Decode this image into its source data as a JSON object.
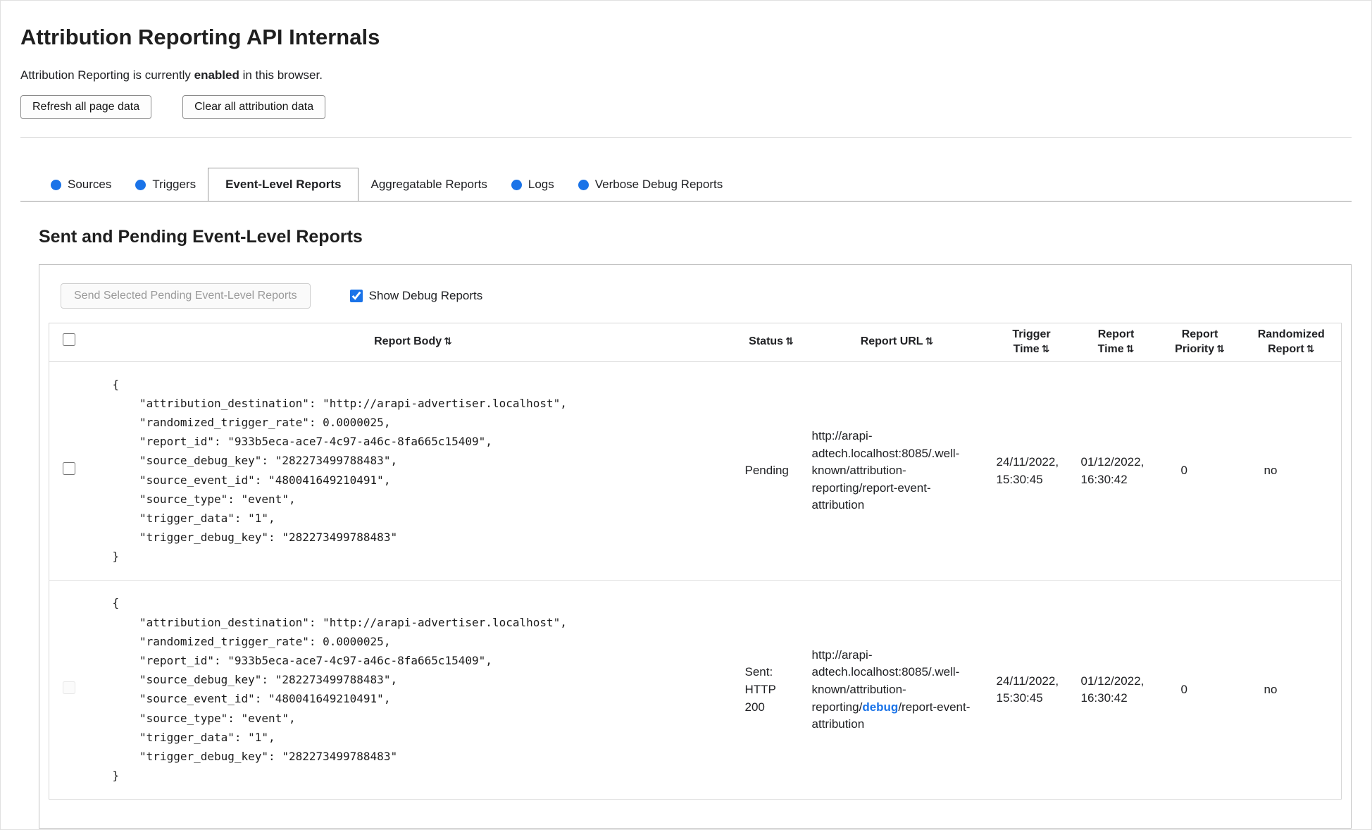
{
  "colors": {
    "accent_blue": "#1a73e8",
    "debug_link_blue": "#1a73e8"
  },
  "header": {
    "title": "Attribution Reporting API Internals",
    "status_prefix": "Attribution Reporting is currently ",
    "status_emphasis": "enabled",
    "status_suffix": " in this browser.",
    "refresh_button": "Refresh all page data",
    "clear_button": "Clear all attribution data"
  },
  "tabs": [
    {
      "label": "Sources",
      "has_dot": true,
      "active": false
    },
    {
      "label": "Triggers",
      "has_dot": true,
      "active": false
    },
    {
      "label": "Event-Level Reports",
      "has_dot": false,
      "active": true
    },
    {
      "label": "Aggregatable Reports",
      "has_dot": false,
      "active": false
    },
    {
      "label": "Logs",
      "has_dot": true,
      "active": false
    },
    {
      "label": "Verbose Debug Reports",
      "has_dot": true,
      "active": false
    }
  ],
  "panel": {
    "heading": "Sent and Pending Event-Level Reports",
    "send_button": "Send Selected Pending Event-Level Reports",
    "send_button_disabled": true,
    "show_debug": {
      "label": "Show Debug Reports",
      "checked": true
    }
  },
  "table": {
    "sort_icon": "⇅",
    "headers": {
      "report_body": "Report Body",
      "status": "Status",
      "report_url": "Report URL",
      "trigger_time": "Trigger Time",
      "report_time": "Report Time",
      "report_priority": "Report Priority",
      "randomized_report": "Randomized Report"
    },
    "rows": [
      {
        "checkbox_disabled": false,
        "body": "{\n    \"attribution_destination\": \"http://arapi-advertiser.localhost\",\n    \"randomized_trigger_rate\": 0.0000025,\n    \"report_id\": \"933b5eca-ace7-4c97-a46c-8fa665c15409\",\n    \"source_debug_key\": \"282273499788483\",\n    \"source_event_id\": \"480041649210491\",\n    \"source_type\": \"event\",\n    \"trigger_data\": \"1\",\n    \"trigger_debug_key\": \"282273499788483\"\n}",
        "status": "Pending",
        "url": "http://arapi-adtech.localhost:8085/.well-known/attribution-reporting/report-event-attribution",
        "trigger_time": "24/11/2022, 15:30:45",
        "report_time": "01/12/2022, 16:30:42",
        "priority": "0",
        "randomized": "no"
      },
      {
        "checkbox_disabled": true,
        "body": "{\n    \"attribution_destination\": \"http://arapi-advertiser.localhost\",\n    \"randomized_trigger_rate\": 0.0000025,\n    \"report_id\": \"933b5eca-ace7-4c97-a46c-8fa665c15409\",\n    \"source_debug_key\": \"282273499788483\",\n    \"source_event_id\": \"480041649210491\",\n    \"source_type\": \"event\",\n    \"trigger_data\": \"1\",\n    \"trigger_debug_key\": \"282273499788483\"\n}",
        "status": "Sent: HTTP 200",
        "url_prefix": "http://arapi-adtech.localhost:8085/.well-known/attribution-reporting/",
        "url_debug": "debug",
        "url_suffix": "/report-event-attribution",
        "trigger_time": "24/11/2022, 15:30:45",
        "report_time": "01/12/2022, 16:30:42",
        "priority": "0",
        "randomized": "no"
      }
    ]
  }
}
